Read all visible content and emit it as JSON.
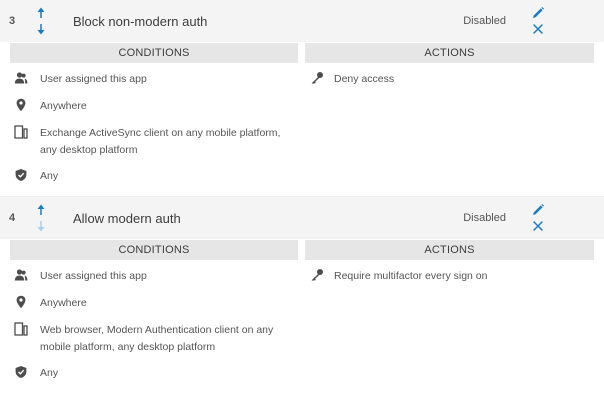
{
  "colors": {
    "accent": "#1a7dc4",
    "accent_light": "#a9d0ee",
    "icon_gray": "#4d4d4d"
  },
  "rules": [
    {
      "number": "3",
      "name": "Block non-modern auth",
      "status": "Disabled",
      "conditions_header": "CONDITIONS",
      "actions_header": "ACTIONS",
      "conditions": [
        {
          "icon": "user-icon",
          "text": "User assigned this app"
        },
        {
          "icon": "location-pin-icon",
          "text": "Anywhere"
        },
        {
          "icon": "devices-icon",
          "text": "Exchange ActiveSync client on any mobile platform, any desktop platform"
        },
        {
          "icon": "shield-icon",
          "text": "Any"
        }
      ],
      "actions": [
        {
          "icon": "key-icon",
          "text": "Deny access"
        }
      ]
    },
    {
      "number": "4",
      "name": "Allow modern auth",
      "status": "Disabled",
      "conditions_header": "CONDITIONS",
      "actions_header": "ACTIONS",
      "conditions": [
        {
          "icon": "user-icon",
          "text": "User assigned this app"
        },
        {
          "icon": "location-pin-icon",
          "text": "Anywhere"
        },
        {
          "icon": "devices-icon",
          "text": "Web browser, Modern Authentication client on any mobile platform, any desktop platform"
        },
        {
          "icon": "shield-icon",
          "text": "Any"
        }
      ],
      "actions": [
        {
          "icon": "key-icon",
          "text": "Require multifactor every sign on"
        }
      ]
    }
  ]
}
